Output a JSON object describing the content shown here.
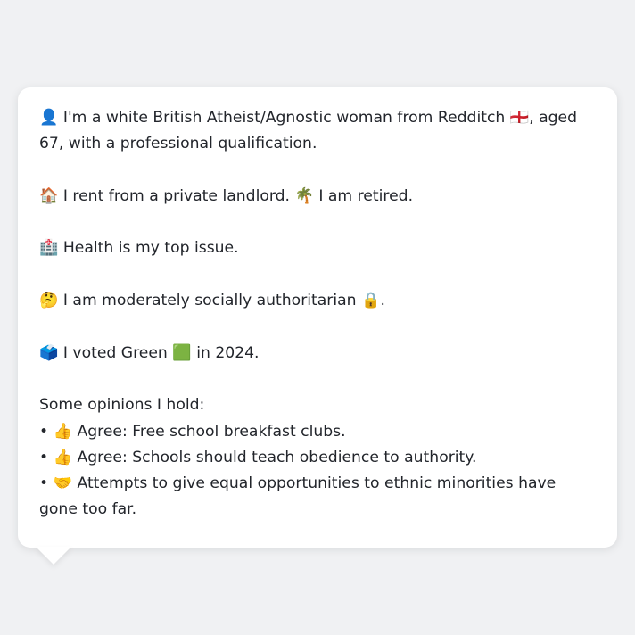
{
  "profile": {
    "identity": {
      "emoji": "👤",
      "text_before_flag": "I'm a white British Atheist/Agnostic woman from Redditch",
      "flag_emoji": "🏴󠁧󠁢󠁥󠁮󠁧󠁿",
      "text_after_flag": ", aged 67, with a professional qualification."
    },
    "housing": {
      "emoji": "🏠",
      "text": "I rent from a private landlord.",
      "work_emoji": "🌴",
      "work_text": "I am retired."
    },
    "top_issue": {
      "emoji": "🏥",
      "text": "Health is my top issue."
    },
    "social": {
      "emoji": "🤔",
      "text": "I am moderately socially authoritarian",
      "icon_emoji": "🔒",
      "suffix": "."
    },
    "vote": {
      "emoji": "🗳️",
      "text_before": "I voted Green",
      "party_emoji": "🟩",
      "text_after": "in 2024."
    },
    "opinions": {
      "heading": "Some opinions I hold:",
      "items": [
        {
          "bullet": "•",
          "emoji": "👍",
          "text": "Agree: Free school breakfast clubs."
        },
        {
          "bullet": "•",
          "emoji": "👍",
          "text": "Agree: Schools should teach obedience to authority."
        },
        {
          "bullet": "•",
          "emoji": "🤝",
          "text": "Attempts to give equal opportunities to ethnic minorities have gone too far."
        }
      ]
    }
  },
  "colors": {
    "background": "#f0f1f3",
    "bubble": "#ffffff",
    "text": "#22252b"
  }
}
